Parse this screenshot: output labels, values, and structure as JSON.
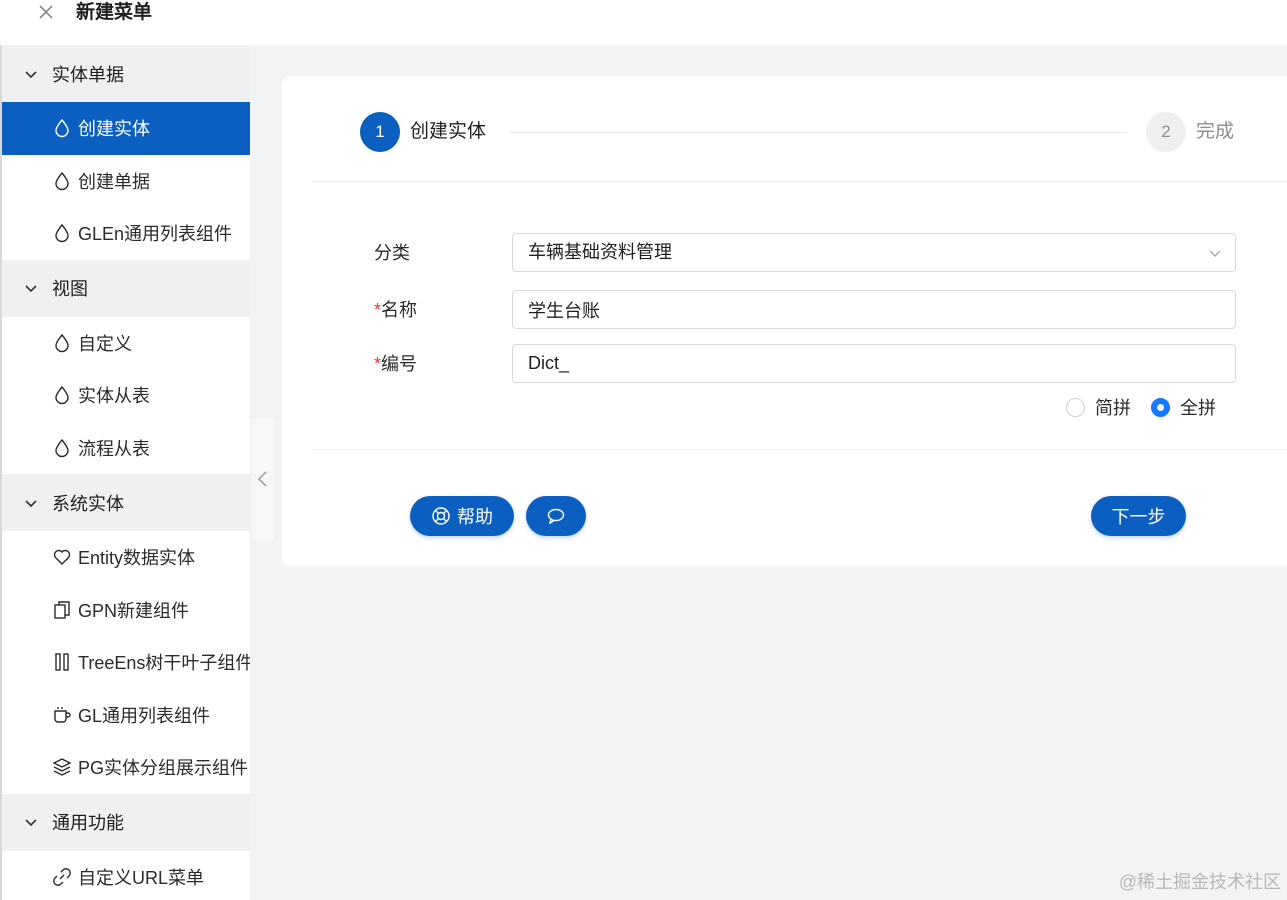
{
  "header": {
    "title": "新建菜单"
  },
  "sidebar": {
    "groups": [
      {
        "title": "实体单据",
        "items": [
          {
            "label": "创建实体",
            "icon": "droplet-icon",
            "active": true
          },
          {
            "label": "创建单据",
            "icon": "droplet-icon"
          },
          {
            "label": "GLEn通用列表组件",
            "icon": "droplet-icon"
          }
        ]
      },
      {
        "title": "视图",
        "items": [
          {
            "label": "自定义",
            "icon": "droplet-icon"
          },
          {
            "label": "实体从表",
            "icon": "droplet-icon"
          },
          {
            "label": "流程从表",
            "icon": "droplet-icon"
          }
        ]
      },
      {
        "title": "系统实体",
        "items": [
          {
            "label": "Entity数据实体",
            "icon": "heart-icon"
          },
          {
            "label": "GPN新建组件",
            "icon": "copy-icon"
          },
          {
            "label": "TreeEns树干叶子组件",
            "icon": "columns-icon"
          },
          {
            "label": "GL通用列表组件",
            "icon": "cup-icon"
          },
          {
            "label": "PG实体分组展示组件",
            "icon": "layers-icon"
          }
        ]
      },
      {
        "title": "通用功能",
        "items": [
          {
            "label": "自定义URL菜单",
            "icon": "link-icon"
          }
        ]
      }
    ]
  },
  "steps": [
    {
      "number": "1",
      "label": "创建实体",
      "state": "active"
    },
    {
      "number": "2",
      "label": "完成",
      "state": "pending"
    }
  ],
  "form": {
    "category": {
      "label": "分类",
      "value": "车辆基础资料管理"
    },
    "name": {
      "required_mark": "*",
      "label": "名称",
      "value": "学生台账"
    },
    "code": {
      "required_mark": "*",
      "label": "编号",
      "value": "Dict_"
    },
    "pinyin_options": [
      {
        "label": "简拼",
        "checked": false
      },
      {
        "label": "全拼",
        "checked": true
      }
    ]
  },
  "buttons": {
    "help_label": "帮助",
    "next_label": "下一步"
  },
  "watermark": "@稀土掘金技术社区",
  "colors": {
    "primary": "#0a5fc0",
    "radio_accent": "#1677ff",
    "required": "#e53935"
  }
}
